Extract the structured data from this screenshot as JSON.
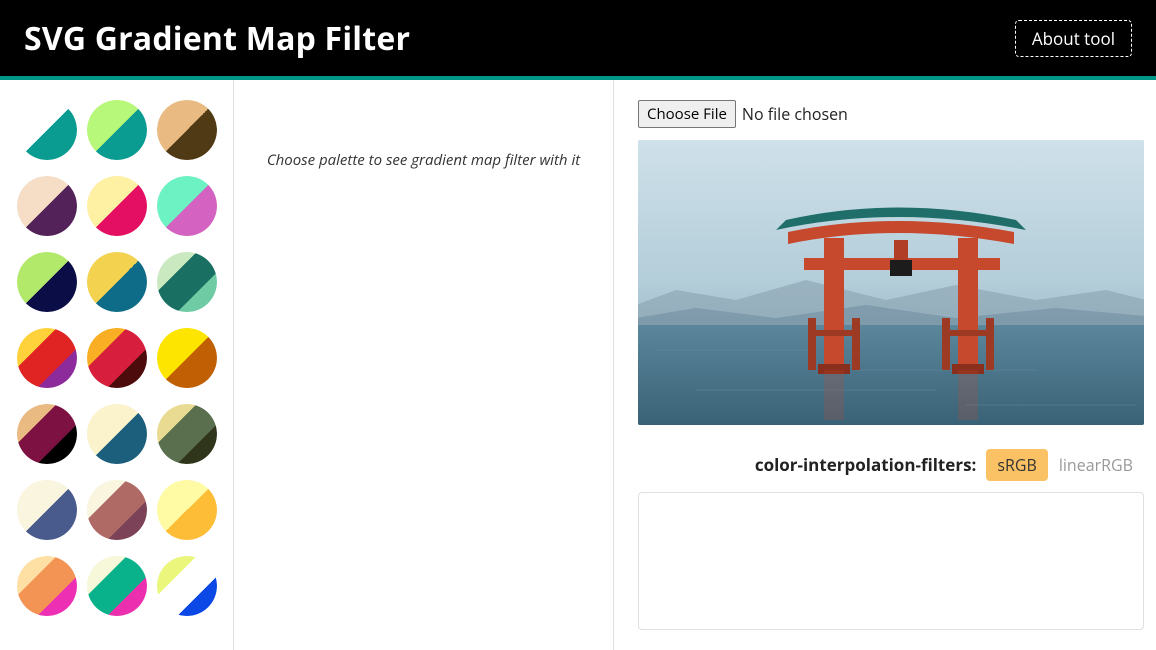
{
  "header": {
    "title": "SVG Gradient Map Filter",
    "about_label": "About tool"
  },
  "sidebar": {
    "palettes": [
      {
        "colors": [
          "#FFFFFF",
          "#0A9C91"
        ]
      },
      {
        "colors": [
          "#B7F779",
          "#0A9C91"
        ]
      },
      {
        "colors": [
          "#E9BA82",
          "#4F3A15"
        ]
      },
      {
        "colors": [
          "#F5DDC6",
          "#522259"
        ]
      },
      {
        "colors": [
          "#FFF1A3",
          "#E40E63"
        ]
      },
      {
        "colors": [
          "#6CF2C3",
          "#D362C1"
        ]
      },
      {
        "colors": [
          "#B2E96A",
          "#0B0E46"
        ]
      },
      {
        "colors": [
          "#F3D24F",
          "#0F6C88"
        ]
      },
      {
        "colors": [
          "#CBE9C1",
          "#186F62",
          "#6ECBA4"
        ]
      },
      {
        "colors": [
          "#FFD23C",
          "#E02323",
          "#8D2A9C"
        ]
      },
      {
        "colors": [
          "#F9AE23",
          "#D71E3C",
          "#4E0B0B"
        ]
      },
      {
        "colors": [
          "#FDE500",
          "#C05F04"
        ]
      },
      {
        "colors": [
          "#E9BA82",
          "#7D1142",
          "#000000"
        ]
      },
      {
        "colors": [
          "#FAF3CC",
          "#1B5F7D"
        ]
      },
      {
        "colors": [
          "#E9DB92",
          "#5A6F4E",
          "#2F351A"
        ]
      },
      {
        "colors": [
          "#FAF5DE",
          "#485B8C"
        ]
      },
      {
        "colors": [
          "#FAF5DE",
          "#B06A66",
          "#7C4257"
        ]
      },
      {
        "colors": [
          "#FFFBA4",
          "#FDBD36"
        ]
      },
      {
        "colors": [
          "#FFE0A4",
          "#F39455",
          "#EC2FB3"
        ]
      },
      {
        "colors": [
          "#F7F8DA",
          "#0AB28B",
          "#EB2FAE"
        ]
      },
      {
        "colors": [
          "#EAF67C",
          "#FFFFFF",
          "#0B48E6"
        ]
      }
    ]
  },
  "middle": {
    "placeholder_text": "Choose palette to see gradient map filter with it"
  },
  "preview": {
    "choose_file_label": "Choose File",
    "file_status": "No file chosen",
    "interp_label": "color-interpolation-filters:",
    "interp_options": [
      {
        "value": "sRGB",
        "active": true
      },
      {
        "value": "linearRGB",
        "active": false
      }
    ]
  }
}
